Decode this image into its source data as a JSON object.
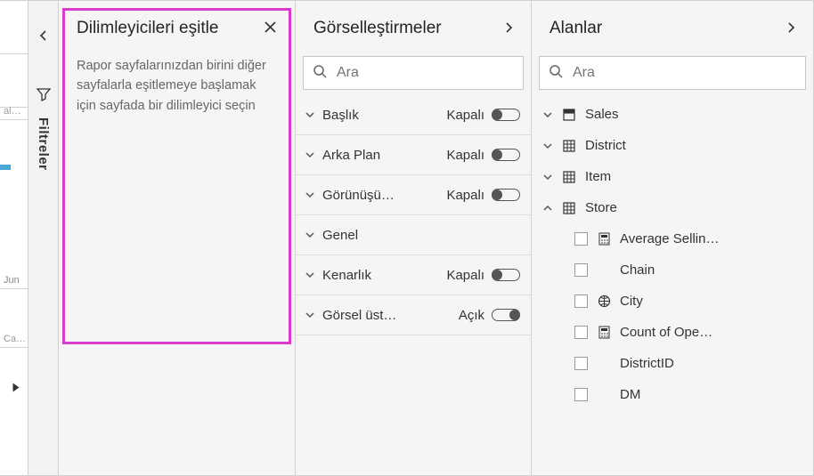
{
  "filters": {
    "label": "Filtreler"
  },
  "sync": {
    "title": "Dilimleyicileri eşitle",
    "desc": "Rapor sayfalarınızdan birini diğer sayfalarla eşitlemeye başlamak için sayfada bir dilimleyici seçin"
  },
  "viz": {
    "title": "Görselleştirmeler",
    "search_placeholder": "Ara",
    "state_on": "Açık",
    "state_off": "Kapalı",
    "rows": {
      "title": {
        "label": "Başlık",
        "state": "Kapalı",
        "on": false,
        "has_toggle": true
      },
      "bg": {
        "label": "Arka Plan",
        "state": "Kapalı",
        "on": false,
        "has_toggle": true
      },
      "aspect": {
        "label": "Görünüşü…",
        "state": "Kapalı",
        "on": false,
        "has_toggle": true
      },
      "general": {
        "label": "Genel",
        "state": "",
        "on": false,
        "has_toggle": false
      },
      "border": {
        "label": "Kenarlık",
        "state": "Kapalı",
        "on": false,
        "has_toggle": true
      },
      "header": {
        "label": "Görsel üst…",
        "state": "Açık",
        "on": true,
        "has_toggle": true
      }
    }
  },
  "fields": {
    "title": "Alanlar",
    "search_placeholder": "Ara",
    "tables": {
      "sales": {
        "label": "Sales",
        "expanded": false
      },
      "district": {
        "label": "District",
        "expanded": false
      },
      "item": {
        "label": "Item",
        "expanded": false
      },
      "store": {
        "label": "Store",
        "expanded": true
      }
    },
    "store_children": {
      "avg": {
        "label": "Average Sellin…",
        "icon": "calc"
      },
      "chain": {
        "label": "Chain",
        "icon": ""
      },
      "city": {
        "label": "City",
        "icon": "globe"
      },
      "count": {
        "label": "Count of Ope…",
        "icon": "calc"
      },
      "districtid": {
        "label": "DistrictID",
        "icon": ""
      },
      "dm": {
        "label": "DM",
        "icon": ""
      }
    }
  },
  "canvas_sliver": {
    "label3": "al…",
    "label4": "Jun",
    "label5": "Ca…"
  }
}
